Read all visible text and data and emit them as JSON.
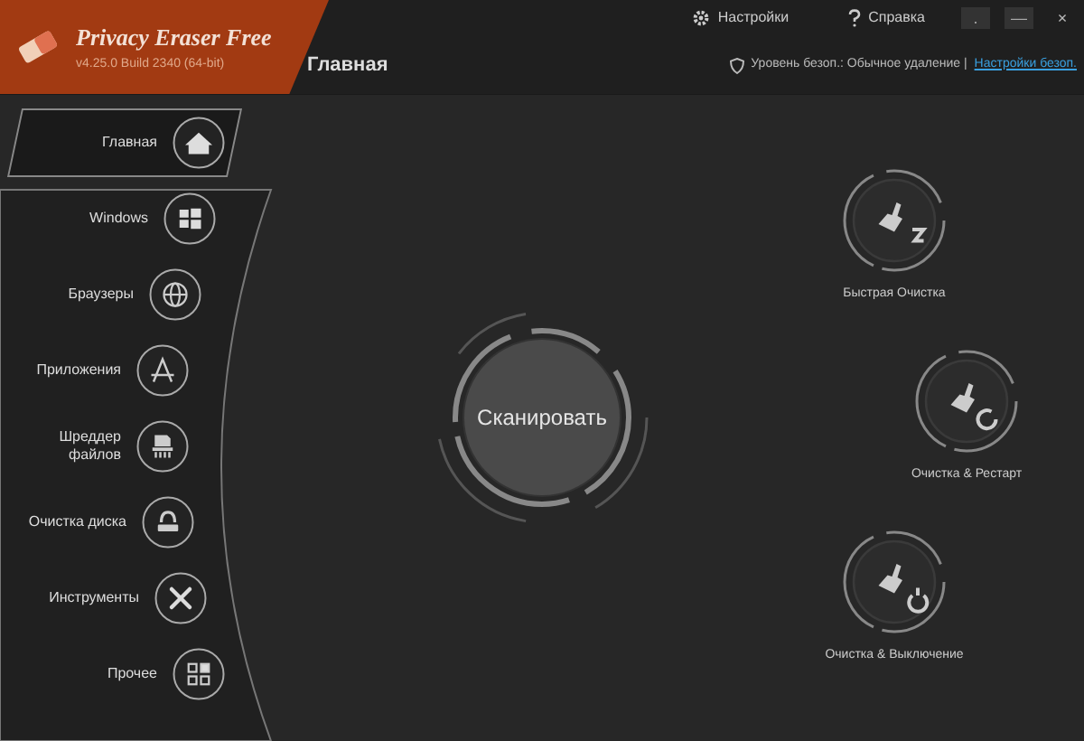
{
  "app": {
    "title": "Privacy Eraser Free",
    "version": "v4.25.0 Build 2340 (64-bit)"
  },
  "top_menu": [
    {
      "kind": "settings",
      "label": "Настройки"
    },
    {
      "kind": "help",
      "label": "Справка"
    }
  ],
  "window_controls": [
    {
      "kind": "dot",
      "label": "."
    },
    {
      "kind": "minimize",
      "label": "—"
    },
    {
      "kind": "close",
      "label": "×"
    }
  ],
  "page_title": "Главная",
  "security": {
    "text": "Уровень безоп.: Обычное удаление |",
    "link": "Настройки безоп."
  },
  "sidebar": {
    "items": [
      {
        "label": "Главная",
        "kind": "home",
        "selected": true
      },
      {
        "label": "Windows",
        "kind": "windows",
        "selected": false
      },
      {
        "label": "Браузеры",
        "kind": "globe",
        "selected": false
      },
      {
        "label": "Приложения",
        "kind": "apps",
        "selected": false
      },
      {
        "label": "Шреддер файлов",
        "kind": "shredder",
        "selected": false
      },
      {
        "label": "Очистка диска",
        "kind": "disk",
        "selected": false
      },
      {
        "label": "Инструменты",
        "kind": "tools",
        "selected": false
      },
      {
        "label": "Прочее",
        "kind": "other",
        "selected": false
      }
    ]
  },
  "scan_button": {
    "label": "Сканировать"
  },
  "actions": [
    {
      "label": "Быстрая Очистка",
      "kind": "quick"
    },
    {
      "label": "Очистка & Рестарт",
      "kind": "restart"
    },
    {
      "label": "Очистка & Выключение",
      "kind": "shutdown"
    }
  ]
}
